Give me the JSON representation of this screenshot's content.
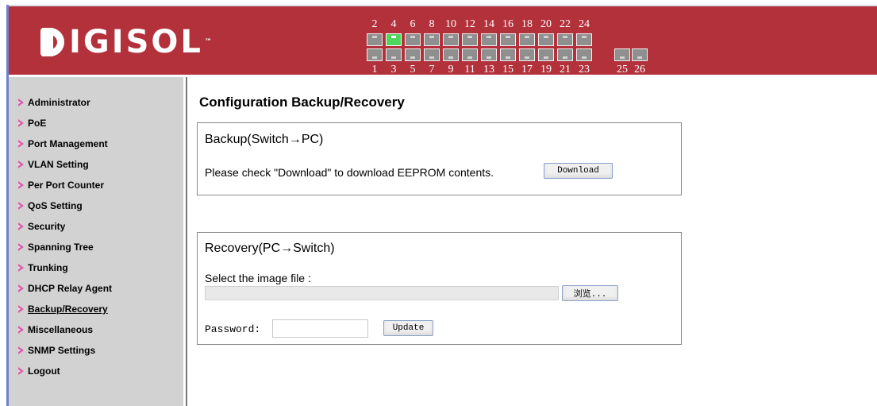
{
  "brand": {
    "logo_text": "IGISOL",
    "logo_full": "DIGISOL",
    "tm": "™",
    "banner_color": "#b2313b"
  },
  "ports": {
    "top_numbers": [
      "2",
      "4",
      "6",
      "8",
      "10",
      "12",
      "14",
      "16",
      "18",
      "20",
      "22",
      "24"
    ],
    "bottom_numbers": [
      "1",
      "3",
      "5",
      "7",
      "9",
      "11",
      "13",
      "15",
      "17",
      "19",
      "21",
      "23"
    ],
    "uplink_numbers": [
      "25",
      "26"
    ],
    "active_port": "4",
    "active_color": "#4fd65f"
  },
  "sidebar": {
    "items": [
      {
        "label": "Administrator"
      },
      {
        "label": "PoE"
      },
      {
        "label": "Port Management"
      },
      {
        "label": "VLAN Setting"
      },
      {
        "label": "Per Port Counter"
      },
      {
        "label": "QoS Setting"
      },
      {
        "label": "Security"
      },
      {
        "label": "Spanning Tree"
      },
      {
        "label": "Trunking"
      },
      {
        "label": "DHCP Relay Agent"
      },
      {
        "label": "Backup/Recovery"
      },
      {
        "label": "Miscellaneous"
      },
      {
        "label": "SNMP Settings"
      },
      {
        "label": "Logout"
      }
    ],
    "current": "Backup/Recovery"
  },
  "main": {
    "title": "Configuration Backup/Recovery",
    "backup": {
      "title": "Backup(Switch→PC)",
      "instruction": "Please check \"Download\" to download EEPROM contents.",
      "download_label": "Download"
    },
    "recovery": {
      "title": "Recovery(PC→Switch)",
      "select_label": "Select the image file :",
      "file_value": "",
      "browse_label": "浏览...",
      "password_label": "Password:",
      "password_value": "",
      "update_label": "Update"
    }
  }
}
